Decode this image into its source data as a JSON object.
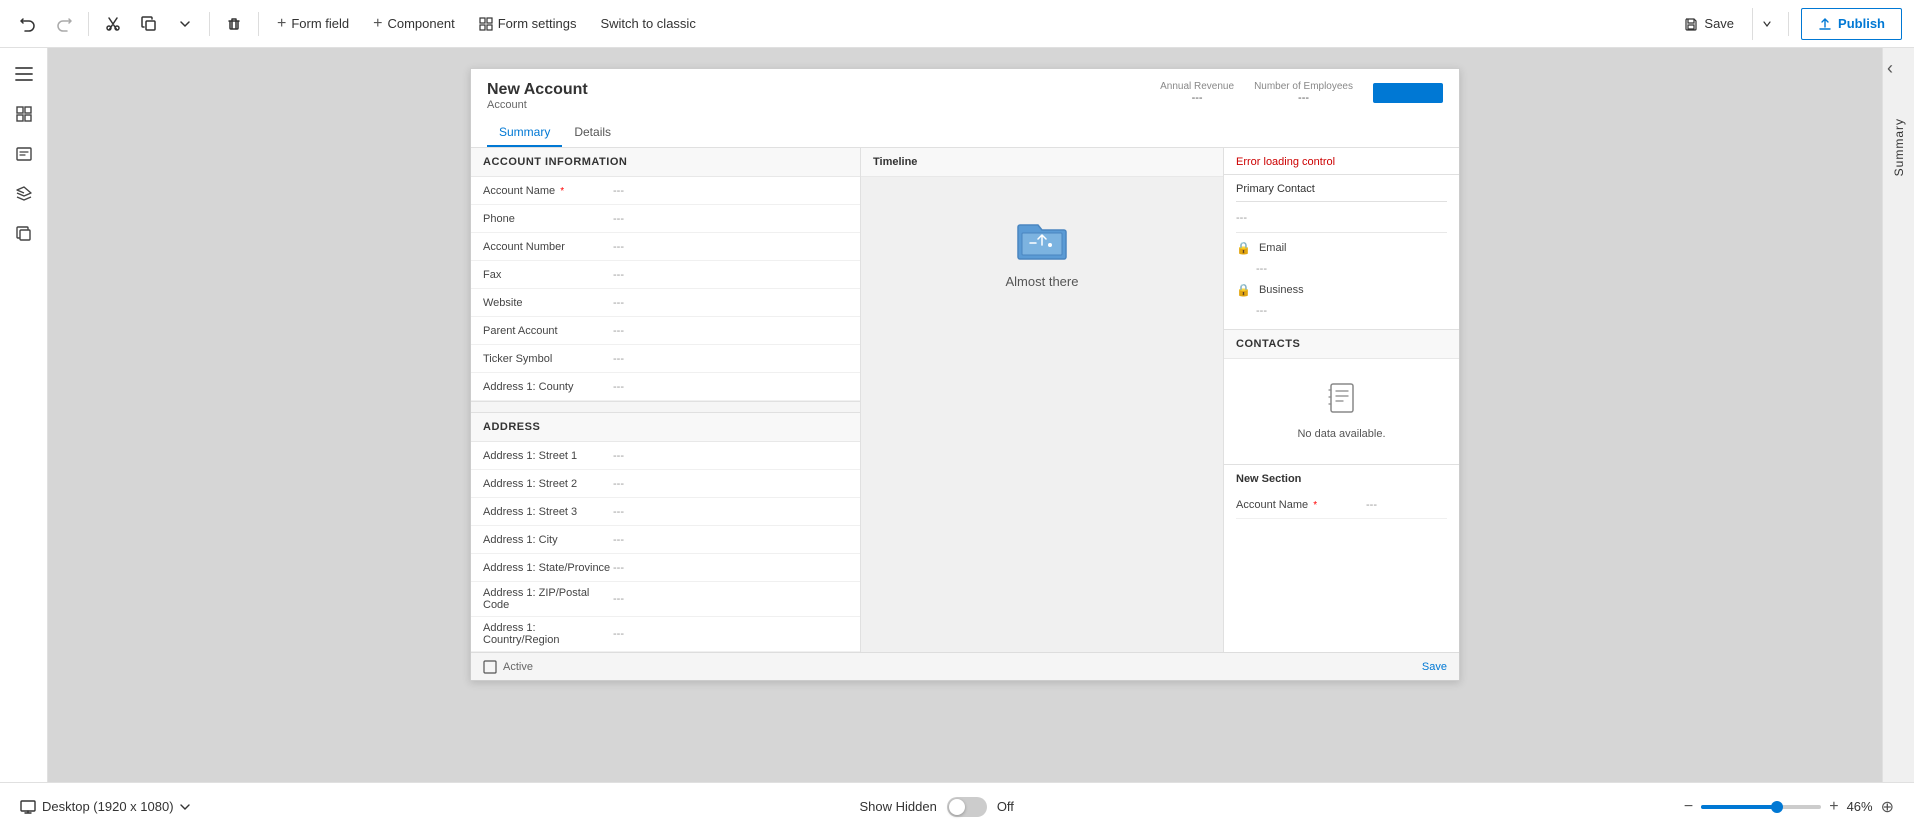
{
  "toolbar": {
    "undo_label": "↩",
    "redo_label": "↪",
    "cut_label": "✂",
    "copy_label": "⎘",
    "dropdown_label": "▾",
    "delete_label": "🗑",
    "form_field_label": "Form field",
    "component_label": "Component",
    "form_settings_label": "Form settings",
    "switch_classic_label": "Switch to classic",
    "save_label": "Save",
    "publish_label": "Publish"
  },
  "left_sidebar": {
    "icons": [
      "☰",
      "⊞",
      "Abc",
      "⧉",
      "❐"
    ]
  },
  "form": {
    "title": "New Account",
    "subtitle": "Account",
    "header_fields": [
      {
        "label": "Annual Revenue",
        "value": "---"
      },
      {
        "label": "Number of Employees",
        "value": "---"
      }
    ],
    "tabs": [
      {
        "label": "Summary",
        "active": true
      },
      {
        "label": "Details",
        "active": false
      }
    ],
    "left_section": {
      "title": "ACCOUNT INFORMATION",
      "fields": [
        {
          "label": "Account Name",
          "required": true,
          "value": "---"
        },
        {
          "label": "Phone",
          "required": false,
          "value": "---"
        },
        {
          "label": "Account Number",
          "required": false,
          "value": "---"
        },
        {
          "label": "Fax",
          "required": false,
          "value": "---"
        },
        {
          "label": "Website",
          "required": false,
          "value": "---"
        },
        {
          "label": "Parent Account",
          "required": false,
          "value": "---"
        },
        {
          "label": "Ticker Symbol",
          "required": false,
          "value": "---"
        },
        {
          "label": "Address 1: County",
          "required": false,
          "value": "---"
        }
      ]
    },
    "address_section": {
      "title": "ADDRESS",
      "fields": [
        {
          "label": "Address 1: Street 1",
          "value": "---"
        },
        {
          "label": "Address 1: Street 2",
          "value": "---"
        },
        {
          "label": "Address 1: Street 3",
          "value": "---"
        },
        {
          "label": "Address 1: City",
          "value": "---"
        },
        {
          "label": "Address 1: State/Province",
          "value": "---"
        },
        {
          "label": "Address 1: ZIP/Postal Code",
          "value": "---"
        },
        {
          "label": "Address 1: Country/Region",
          "value": "---"
        }
      ]
    },
    "timeline": {
      "header": "Timeline",
      "icon": "📁",
      "text": "Almost there"
    },
    "right_panel": {
      "error_text": "Error loading control",
      "primary_contact": {
        "label": "Primary Contact",
        "value": "---",
        "email_label": "Email",
        "email_value": "---",
        "business_label": "Business",
        "business_value": "---"
      },
      "contacts": {
        "title": "CONTACTS",
        "empty_text": "No data available.",
        "icon": "📄"
      },
      "new_section": {
        "title": "New Section",
        "fields": [
          {
            "label": "Account Name",
            "required": true,
            "value": "---"
          }
        ]
      }
    }
  },
  "bottom_form_bar": {
    "status": "Active",
    "save_label": "Save"
  },
  "bottom_toolbar": {
    "desktop_label": "Desktop (1920 x 1080)",
    "show_hidden_label": "Show Hidden",
    "toggle_state": "Off",
    "zoom_label": "46%"
  },
  "right_sidebar": {
    "label": "Summary"
  }
}
